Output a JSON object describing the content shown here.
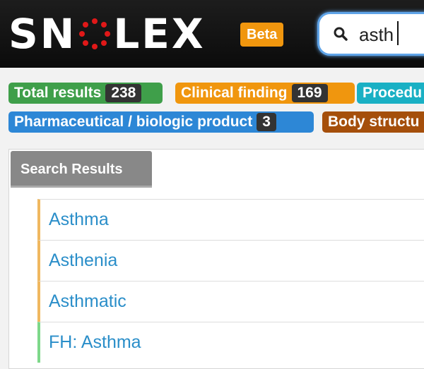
{
  "header": {
    "logo_text": "SNOLEX",
    "beta_label": "Beta"
  },
  "search": {
    "value": "asth",
    "icon": "search-icon"
  },
  "badges": [
    {
      "label": "Total results",
      "count": "238",
      "color": "#3f9f4a"
    },
    {
      "label": "Clinical finding",
      "count": "169",
      "color": "#f0960e"
    },
    {
      "label": "Procedu",
      "color": "#1ab0c4"
    },
    {
      "label": "Pharmaceutical / biologic product",
      "count": "3",
      "color": "#2d87d6"
    },
    {
      "label": "Body structu",
      "color": "#a54f0b"
    }
  ],
  "panel": {
    "tab_label": "Search Results"
  },
  "results": [
    {
      "label": "Asthma",
      "accent": "#f0b860"
    },
    {
      "label": "Asthenia",
      "accent": "#f0b860"
    },
    {
      "label": "Asthmatic",
      "accent": "#f0b860"
    },
    {
      "label": "FH: Asthma",
      "accent": "#7ed88a"
    }
  ]
}
